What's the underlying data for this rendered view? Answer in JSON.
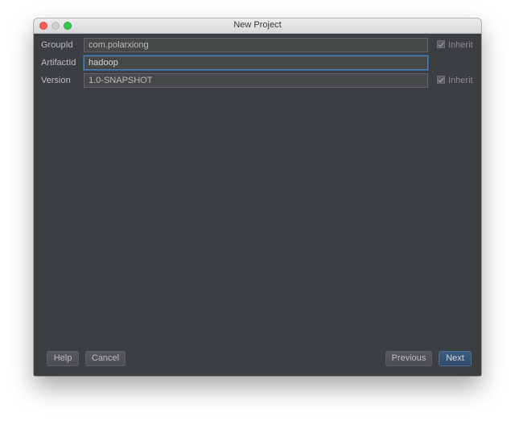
{
  "window": {
    "title": "New Project"
  },
  "form": {
    "group_id": {
      "label": "GroupId",
      "value": "com.polarxiong",
      "inherit_label": "Inherit",
      "inherit_checked": true
    },
    "artifact_id": {
      "label": "ArtifactId",
      "value": "hadoop"
    },
    "version": {
      "label": "Version",
      "value": "1.0-SNAPSHOT",
      "inherit_label": "Inherit",
      "inherit_checked": true
    }
  },
  "buttons": {
    "help": "Help",
    "cancel": "Cancel",
    "previous": "Previous",
    "next": "Next"
  },
  "colors": {
    "background": "#3c3f41",
    "focus_border": "#4f7fb3",
    "default_button": "#3a5b81"
  }
}
